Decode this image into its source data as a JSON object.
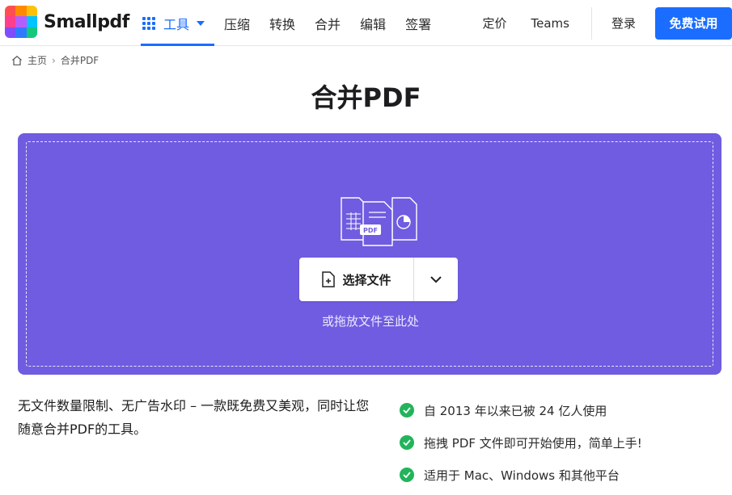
{
  "brand": {
    "name": "Smallpdf"
  },
  "nav": {
    "tools_label": "工具",
    "items": [
      "压缩",
      "转换",
      "合并",
      "编辑",
      "签署"
    ]
  },
  "right_nav": {
    "pricing": "定价",
    "teams": "Teams",
    "login": "登录",
    "trial": "免费试用"
  },
  "breadcrumb": {
    "home": "主页",
    "current": "合并PDF"
  },
  "page": {
    "title": "合并PDF"
  },
  "dropzone": {
    "graphic_label": "PDF",
    "choose_label": "选择文件",
    "hint": "或拖放文件至此处"
  },
  "description": "无文件数量限制、无广告水印 – 一款既免费又美观，同时让您随意合并PDF的工具。",
  "features": [
    "自 2013 年以来已被 24 亿人使用",
    "拖拽 PDF 文件即可开始使用，简单上手!",
    "适用于 Mac、Windows 和其他平台"
  ],
  "colors": {
    "brand_blue": "#1a6dff",
    "dropzone_purple": "#6f5ce0",
    "check_green": "#22b45b"
  },
  "icons": {
    "home": "home-icon",
    "grid": "grid-icon",
    "file_add": "file-add-icon",
    "chevron": "chevron-down-icon",
    "check": "check-circle-icon"
  }
}
